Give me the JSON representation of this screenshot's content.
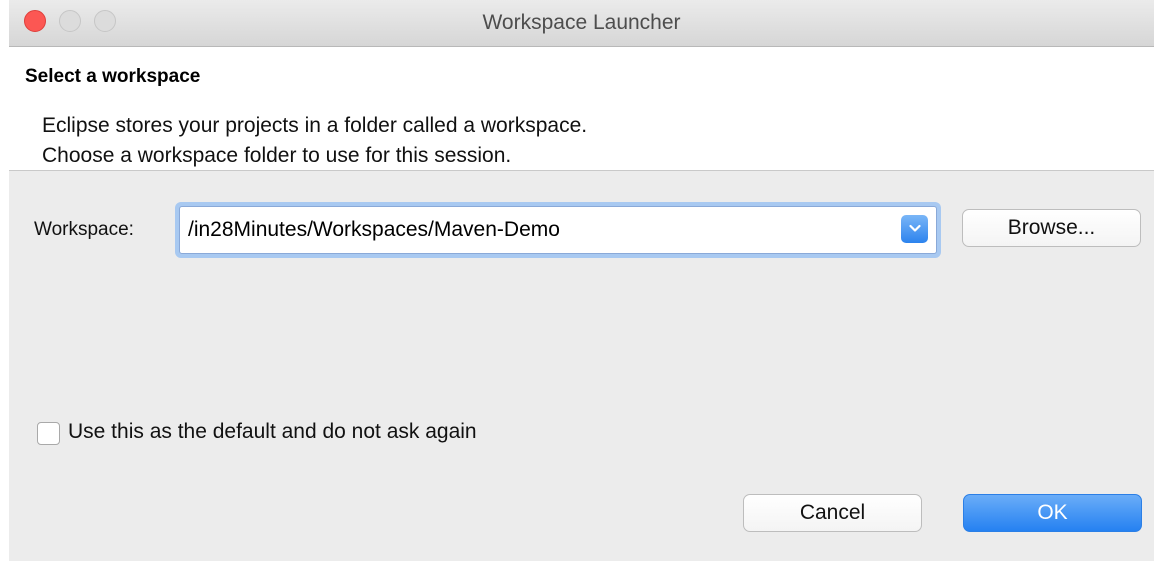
{
  "window": {
    "title": "Workspace Launcher"
  },
  "header": {
    "title": "Select a workspace",
    "description_line1": "Eclipse stores your projects in a folder called a workspace.",
    "description_line2": "Choose a workspace folder to use for this session."
  },
  "workspace": {
    "label": "Workspace:",
    "value": "/in28Minutes/Workspaces/Maven-Demo",
    "browse_label": "Browse..."
  },
  "default_option": {
    "label": "Use this as the default and do not ask again",
    "checked": false
  },
  "buttons": {
    "cancel_label": "Cancel",
    "ok_label": "OK"
  },
  "colors": {
    "close_button": "#fc5753",
    "ok_button": "#2581f1",
    "focus_ring": "#a8c9f1"
  }
}
